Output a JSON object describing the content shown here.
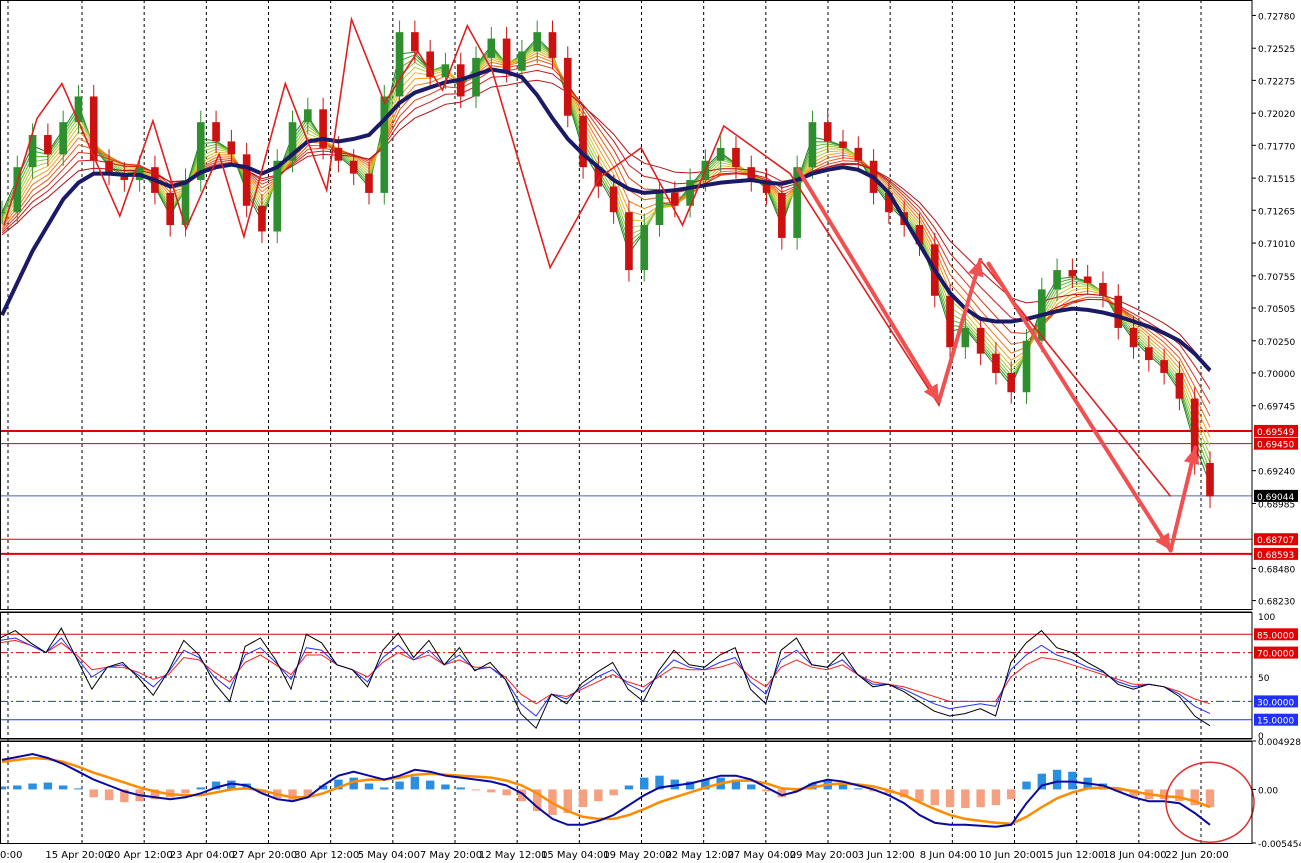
{
  "colors": {
    "background": "#ffffff",
    "axis": "#000000",
    "grid": "#000000",
    "bull_candle": "#2f8f2f",
    "bear_candle": "#cc1111",
    "ma_slow": "#1a1a66",
    "zigzag": "#e02020",
    "arrows": "#f05050",
    "level_lines": "#e00000",
    "current_line": "#4060d0",
    "stoch_main": "#000000",
    "stoch_blue": "#2030ff",
    "stoch_red": "#ff2020",
    "macd_line": "#0a0aa0",
    "signal_line": "#ff8c00",
    "hist_pos": "#2a8fe0",
    "hist_neg": "#f5a080",
    "circle": "#e03030"
  },
  "chart_data": [
    {
      "type": "line",
      "panel": "price",
      "ylim": [
        0.6818,
        0.729
      ],
      "y_ticks": [
        "0.72780",
        "0.72525",
        "0.72275",
        "0.72020",
        "0.71770",
        "0.71515",
        "0.71265",
        "0.71010",
        "0.70755",
        "0.70505",
        "0.70250",
        "0.70000",
        "0.69745",
        "0.69240",
        "0.68985",
        "0.68480",
        "0.68230"
      ],
      "x_ticks": [
        "15 Apr 20:00",
        "20 Apr 12:00",
        "23 Apr 04:00",
        "27 Apr 20:00",
        "30 Apr 12:00",
        "5 May 04:00",
        "7 May 20:00",
        "12 May 12:00",
        "15 May 04:00",
        "19 May 20:00",
        "22 May 12:00",
        "27 May 04:00",
        "29 May 20:00",
        "3 Jun 12:00",
        "8 Jun 04:00",
        "10 Jun 20:00",
        "15 Jun 12:00",
        "18 Jun 04:00",
        "22 Jun 20:00"
      ],
      "x_ticks_partial_left": "0:00",
      "levels": [
        {
          "label": "0.69549",
          "value": 0.69549
        },
        {
          "label": "0.69450",
          "value": 0.6945
        },
        {
          "label": "0.68707",
          "value": 0.68707
        },
        {
          "label": "0.68593",
          "value": 0.68593
        }
      ],
      "current_price": {
        "label": "0.69044",
        "value": 0.69044
      },
      "series": [
        {
          "role": "close",
          "values": [
            0.7125,
            0.716,
            0.7185,
            0.717,
            0.7195,
            0.7215,
            0.7165,
            0.7155,
            0.715,
            0.716,
            0.714,
            0.7115,
            0.715,
            0.7195,
            0.718,
            0.717,
            0.713,
            0.711,
            0.7165,
            0.7195,
            0.7205,
            0.7175,
            0.7165,
            0.7155,
            0.714,
            0.7215,
            0.7265,
            0.725,
            0.723,
            0.724,
            0.7215,
            0.7245,
            0.726,
            0.7235,
            0.725,
            0.7265,
            0.7245,
            0.72,
            0.716,
            0.7145,
            0.7125,
            0.708,
            0.7115,
            0.714,
            0.713,
            0.715,
            0.7165,
            0.7175,
            0.716,
            0.715,
            0.714,
            0.7105,
            0.716,
            0.7195,
            0.718,
            0.7175,
            0.7165,
            0.714,
            0.7125,
            0.7115,
            0.71,
            0.706,
            0.702,
            0.7035,
            0.7015,
            0.7,
            0.6985,
            0.7025,
            0.7065,
            0.708,
            0.7075,
            0.707,
            0.706,
            0.7035,
            0.702,
            0.701,
            0.7,
            0.698,
            0.693,
            0.6904
          ]
        },
        {
          "role": "slow_ma",
          "values": [
            0.7045,
            0.707,
            0.7095,
            0.7115,
            0.7135,
            0.7148,
            0.7155,
            0.7155,
            0.7154,
            0.7154,
            0.715,
            0.7145,
            0.7148,
            0.7156,
            0.716,
            0.7162,
            0.716,
            0.7155,
            0.716,
            0.717,
            0.718,
            0.7182,
            0.718,
            0.7182,
            0.7185,
            0.7197,
            0.721,
            0.7218,
            0.7222,
            0.7226,
            0.7228,
            0.7232,
            0.7236,
            0.7234,
            0.723,
            0.7216,
            0.7198,
            0.7182,
            0.717,
            0.716,
            0.715,
            0.7143,
            0.714,
            0.7141,
            0.7142,
            0.7144,
            0.7146,
            0.7148,
            0.7149,
            0.715,
            0.7148,
            0.7147,
            0.715,
            0.7155,
            0.7158,
            0.716,
            0.7158,
            0.7152,
            0.714,
            0.712,
            0.71,
            0.708,
            0.7062,
            0.705,
            0.7042,
            0.704,
            0.704,
            0.7042,
            0.7045,
            0.7048,
            0.705,
            0.7049,
            0.7047,
            0.7044,
            0.704,
            0.7036,
            0.7031,
            0.7025,
            0.7015,
            0.7002
          ]
        }
      ],
      "zigzag": [
        {
          "t": 0,
          "v": 0.7115
        },
        {
          "t": 4,
          "v": 0.7198
        },
        {
          "t": 7,
          "v": 0.7225
        },
        {
          "t": 14,
          "v": 0.7122
        },
        {
          "t": 18,
          "v": 0.7196
        },
        {
          "t": 22,
          "v": 0.7112
        },
        {
          "t": 26,
          "v": 0.717
        },
        {
          "t": 29,
          "v": 0.7106
        },
        {
          "t": 34,
          "v": 0.7225
        },
        {
          "t": 39,
          "v": 0.7142
        },
        {
          "t": 42,
          "v": 0.7275
        },
        {
          "t": 46,
          "v": 0.721
        },
        {
          "t": 50,
          "v": 0.725
        },
        {
          "t": 53,
          "v": 0.722
        },
        {
          "t": 56,
          "v": 0.727
        },
        {
          "t": 59,
          "v": 0.7235
        },
        {
          "t": 66,
          "v": 0.7082
        },
        {
          "t": 72,
          "v": 0.7152
        },
        {
          "t": 77,
          "v": 0.7175
        },
        {
          "t": 82,
          "v": 0.7115
        },
        {
          "t": 87,
          "v": 0.7192
        },
        {
          "t": 95,
          "v": 0.7155
        },
        {
          "t": 113,
          "v": 0.6975
        },
        {
          "t": 118,
          "v": 0.7088
        },
        {
          "t": 141,
          "v": 0.6904
        }
      ],
      "arrows": [
        {
          "from": {
            "t": 96,
            "v": 0.7158
          },
          "to": {
            "t": 113,
            "v": 0.6978
          }
        },
        {
          "from": {
            "t": 113,
            "v": 0.6978
          },
          "to": {
            "t": 118,
            "v": 0.7088
          }
        },
        {
          "from": {
            "t": 119,
            "v": 0.7085
          },
          "to": {
            "t": 141,
            "v": 0.6862
          }
        },
        {
          "from": {
            "t": 141,
            "v": 0.6862
          },
          "to": {
            "t": 144,
            "v": 0.6942
          }
        }
      ]
    },
    {
      "type": "line",
      "panel": "stochastic",
      "ylim": [
        0,
        100
      ],
      "y_ticks": [
        "100",
        "85.0000",
        "70.0000",
        "50",
        "30.0000",
        "15.0000",
        "0"
      ],
      "levels": [
        {
          "label": "85.0000",
          "value": 85
        },
        {
          "label": "70.0000",
          "value": 70
        },
        {
          "label": "50",
          "value": 50
        },
        {
          "label": "30.0000",
          "value": 30
        },
        {
          "label": "15.0000",
          "value": 15
        }
      ],
      "series": [
        {
          "role": "main",
          "values": [
            82,
            88,
            78,
            70,
            90,
            65,
            40,
            58,
            62,
            50,
            35,
            55,
            80,
            68,
            45,
            30,
            75,
            82,
            64,
            40,
            85,
            78,
            60,
            56,
            42,
            72,
            86,
            66,
            80,
            60,
            74,
            55,
            62,
            48,
            20,
            8,
            36,
            28,
            45,
            54,
            62,
            40,
            30,
            55,
            72,
            60,
            58,
            68,
            74,
            40,
            28,
            72,
            82,
            60,
            58,
            70,
            52,
            42,
            44,
            38,
            30,
            22,
            18,
            20,
            24,
            18,
            62,
            78,
            88,
            74,
            70,
            62,
            55,
            44,
            40,
            44,
            42,
            34,
            18,
            10
          ]
        },
        {
          "role": "blue",
          "values": [
            80,
            82,
            76,
            70,
            82,
            66,
            50,
            58,
            60,
            52,
            42,
            54,
            72,
            66,
            50,
            40,
            68,
            74,
            62,
            48,
            74,
            72,
            60,
            56,
            46,
            66,
            76,
            64,
            72,
            60,
            68,
            56,
            58,
            48,
            28,
            18,
            36,
            32,
            42,
            50,
            56,
            44,
            38,
            52,
            64,
            58,
            56,
            62,
            66,
            46,
            36,
            64,
            72,
            60,
            58,
            64,
            52,
            44,
            44,
            40,
            34,
            28,
            24,
            26,
            28,
            26,
            56,
            68,
            76,
            68,
            64,
            58,
            54,
            46,
            42,
            44,
            42,
            36,
            26,
            20
          ]
        },
        {
          "role": "red",
          "values": [
            78,
            80,
            76,
            70,
            78,
            68,
            56,
            58,
            58,
            54,
            48,
            52,
            66,
            64,
            54,
            46,
            62,
            68,
            60,
            52,
            68,
            68,
            60,
            56,
            50,
            62,
            70,
            64,
            68,
            60,
            64,
            58,
            58,
            50,
            36,
            28,
            36,
            34,
            40,
            46,
            52,
            46,
            42,
            50,
            58,
            56,
            56,
            58,
            62,
            50,
            42,
            58,
            64,
            58,
            56,
            60,
            52,
            46,
            44,
            42,
            38,
            34,
            30,
            30,
            30,
            30,
            50,
            60,
            66,
            64,
            60,
            56,
            52,
            48,
            44,
            44,
            42,
            38,
            32,
            28
          ]
        }
      ]
    },
    {
      "type": "bar",
      "panel": "macd",
      "ylim": [
        -0.005454,
        0.004928
      ],
      "y_ticks": [
        "0.0049282",
        "0.00",
        "-0.0054543"
      ],
      "series": [
        {
          "role": "histogram",
          "values": [
            0.0003,
            0.0004,
            0.0006,
            0.0007,
            0.0004,
            0.0001,
            -0.0008,
            -0.0011,
            -0.0013,
            -0.0012,
            -0.001,
            -0.0008,
            -0.0004,
            0.0002,
            0.0008,
            0.0009,
            0.0006,
            -0.0004,
            -0.0009,
            -0.0012,
            -0.0008,
            0.0004,
            0.001,
            0.0012,
            0.0006,
            0.0002,
            0.0008,
            0.0013,
            0.0009,
            0.0005,
            0.0002,
            -0.0001,
            -0.0003,
            -0.0006,
            -0.0012,
            -0.0022,
            -0.0026,
            -0.0024,
            -0.0018,
            -0.0012,
            -0.0006,
            0.0004,
            0.0012,
            0.0014,
            0.001,
            0.0008,
            0.001,
            0.0012,
            0.001,
            0.0005,
            -0.0002,
            -0.0008,
            -0.0002,
            0.0006,
            0.0009,
            0.0005,
            0.0001,
            -0.0002,
            -0.0004,
            -0.0008,
            -0.0012,
            -0.0016,
            -0.0018,
            -0.0019,
            -0.0018,
            -0.0016,
            -0.001,
            0.0008,
            0.0016,
            0.002,
            0.0018,
            0.0012,
            0.0006,
            -0.0002,
            -0.0008,
            -0.001,
            -0.001,
            -0.0012,
            -0.0016,
            -0.0018
          ]
        },
        {
          "role": "macd",
          "values": [
            0.003,
            0.0033,
            0.0036,
            0.0032,
            0.0026,
            0.0018,
            0.001,
            0.0004,
            -0.0002,
            -0.0006,
            -0.0008,
            -0.001,
            -0.0008,
            -0.0004,
            0.0002,
            0.0006,
            0.0004,
            -0.0004,
            -0.001,
            -0.0012,
            -0.0008,
            0.0004,
            0.0014,
            0.0018,
            0.0014,
            0.001,
            0.0014,
            0.002,
            0.0018,
            0.0014,
            0.0012,
            0.001,
            0.0008,
            0.0004,
            -0.0004,
            -0.0018,
            -0.003,
            -0.0036,
            -0.0036,
            -0.0032,
            -0.0026,
            -0.0016,
            -0.0006,
            0.0002,
            0.0004,
            0.0006,
            0.001,
            0.0014,
            0.0014,
            0.001,
            0.0002,
            -0.0006,
            -0.0002,
            0.0006,
            0.001,
            0.0008,
            0.0004,
            0.0,
            -0.0006,
            -0.0014,
            -0.0026,
            -0.0034,
            -0.0036,
            -0.0036,
            -0.0037,
            -0.0038,
            -0.0036,
            -0.0014,
            0.0004,
            0.0008,
            0.0008,
            0.0006,
            0.0004,
            -0.0002,
            -0.0008,
            -0.0012,
            -0.0012,
            -0.0014,
            -0.0024,
            -0.0036
          ]
        },
        {
          "role": "signal",
          "values": [
            0.0028,
            0.003,
            0.0032,
            0.0031,
            0.0028,
            0.0023,
            0.0017,
            0.0012,
            0.0007,
            0.0002,
            -0.0002,
            -0.0005,
            -0.0006,
            -0.0006,
            -0.0003,
            0.0,
            0.0001,
            -0.0001,
            -0.0005,
            -0.0008,
            -0.0008,
            -0.0004,
            0.0002,
            0.0008,
            0.001,
            0.001,
            0.0012,
            0.0015,
            0.0016,
            0.0015,
            0.0014,
            0.0013,
            0.0012,
            0.0009,
            0.0004,
            -0.0004,
            -0.0014,
            -0.0022,
            -0.0028,
            -0.003,
            -0.003,
            -0.0026,
            -0.002,
            -0.0013,
            -0.0008,
            -0.0003,
            0.0002,
            0.0006,
            0.0009,
            0.0009,
            0.0006,
            0.0001,
            0.0,
            0.0002,
            0.0005,
            0.0006,
            0.0005,
            0.0003,
            -0.0001,
            -0.0006,
            -0.0013,
            -0.002,
            -0.0026,
            -0.003,
            -0.0032,
            -0.0034,
            -0.0035,
            -0.0028,
            -0.0018,
            -0.0009,
            -0.0003,
            0.0001,
            0.0002,
            0.0001,
            -0.0002,
            -0.0005,
            -0.0007,
            -0.0008,
            -0.0012,
            -0.0018
          ]
        }
      ]
    }
  ]
}
